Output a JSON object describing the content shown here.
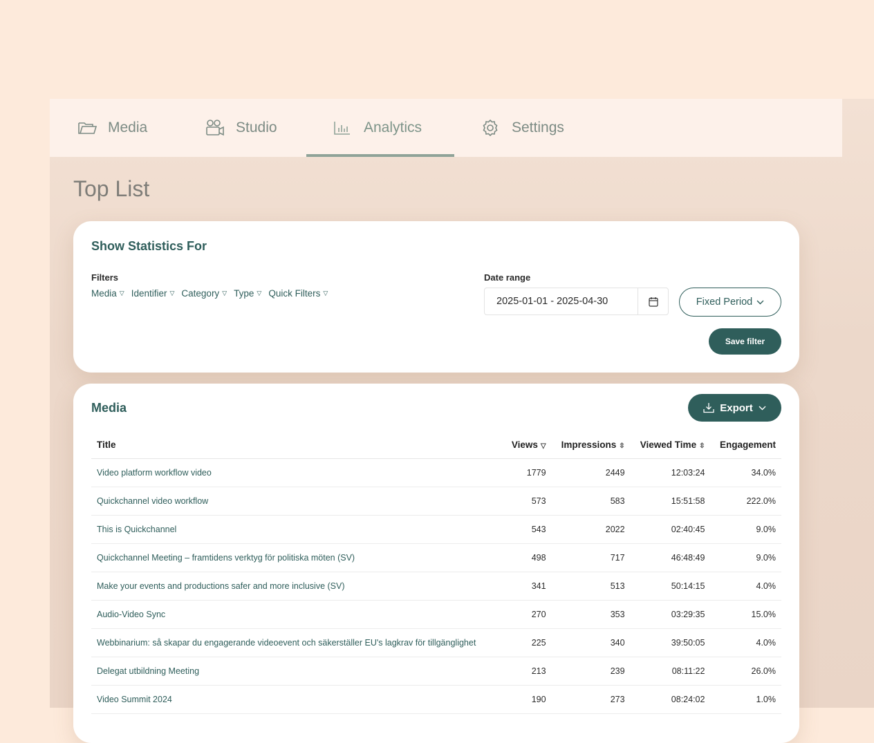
{
  "nav": {
    "media": "Media",
    "studio": "Studio",
    "analytics": "Analytics",
    "settings": "Settings"
  },
  "page_title": "Top List",
  "stats": {
    "title": "Show Statistics For",
    "filters_label": "Filters",
    "filters": [
      "Media",
      "Identifier",
      "Category",
      "Type",
      "Quick Filters"
    ],
    "date_range_label": "Date range",
    "date_range_value": "2025-01-01 - 2025-04-30",
    "fixed_period": "Fixed Period",
    "save_filter": "Save filter"
  },
  "media": {
    "title": "Media",
    "export": "Export",
    "columns": [
      "Title",
      "Views",
      "Impressions",
      "Viewed Time",
      "Engagement"
    ],
    "rows": [
      [
        "Video platform workflow video",
        "1779",
        "2449",
        "12:03:24",
        "34.0%"
      ],
      [
        "Quickchannel video workflow",
        "573",
        "583",
        "15:51:58",
        "222.0%"
      ],
      [
        "This is Quickchannel",
        "543",
        "2022",
        "02:40:45",
        "9.0%"
      ],
      [
        "Quickchannel Meeting – framtidens verktyg för politiska möten (SV)",
        "498",
        "717",
        "46:48:49",
        "9.0%"
      ],
      [
        "Make your events and productions safer and more inclusive (SV)",
        "341",
        "513",
        "50:14:15",
        "4.0%"
      ],
      [
        "Audio-Video Sync",
        "270",
        "353",
        "03:29:35",
        "15.0%"
      ],
      [
        "Webbinarium: så skapar du engagerande videoevent och säkerställer EU's lagkrav för tillgänglighet",
        "225",
        "340",
        "39:50:05",
        "4.0%"
      ],
      [
        "Delegat utbildning Meeting",
        "213",
        "239",
        "08:11:22",
        "26.0%"
      ],
      [
        "Video Summit 2024",
        "190",
        "273",
        "08:24:02",
        "1.0%"
      ]
    ]
  }
}
